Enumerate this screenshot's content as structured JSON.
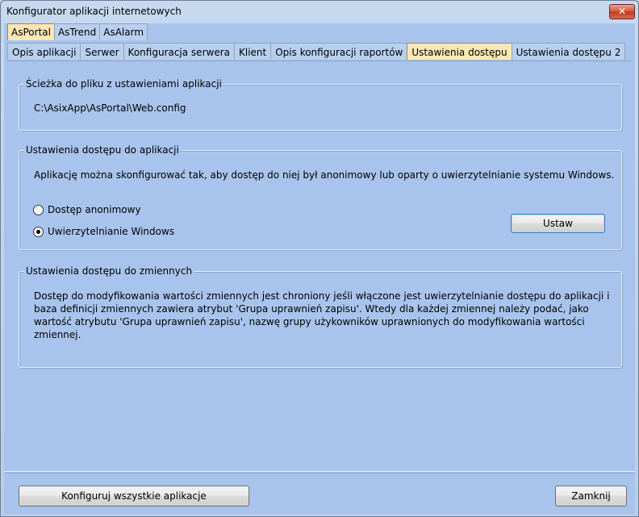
{
  "window": {
    "title": "Konfigurator aplikacji internetowych",
    "close_glyph": "✕"
  },
  "apps_tabs": [
    {
      "label": "AsPortal",
      "active": true
    },
    {
      "label": "AsTrend",
      "active": false
    },
    {
      "label": "AsAlarm",
      "active": false
    }
  ],
  "page_tabs": [
    {
      "label": "Opis aplikacji",
      "active": false
    },
    {
      "label": "Serwer",
      "active": false
    },
    {
      "label": "Konfiguracja serwera",
      "active": false
    },
    {
      "label": "Klient",
      "active": false
    },
    {
      "label": "Opis konfiguracji raportów",
      "active": false
    },
    {
      "label": "Ustawienia dostępu",
      "active": true
    },
    {
      "label": "Ustawienia dostępu 2",
      "active": false
    }
  ],
  "config_path_group": {
    "title": "Ścieżka do pliku z ustawieniami aplikacji",
    "path": "C:\\AsixApp\\AsPortal\\Web.config"
  },
  "access_group": {
    "title": "Ustawienia dostępu do aplikacji",
    "description": "Aplikację można skonfigurować tak, aby dostęp do niej był anonimowy lub oparty o uwierzytelnianie systemu Windows.",
    "option_anonymous": "Dostęp anonimowy",
    "option_windows": "Uwierzytelnianie Windows",
    "selected": "windows",
    "set_button": "Ustaw"
  },
  "variables_group": {
    "title": "Ustawienia dostępu do zmiennych",
    "description": "Dostęp do modyfikowania wartości zmiennych jest chroniony jeśli włączone jest uwierzytelnianie dostępu do aplikacji i baza definicji zmiennych zawiera atrybut 'Grupa uprawnień zapisu'. Wtedy dla każdej zmiennej należy podać, jako wartość atrybutu 'Grupa uprawnień zapisu', nazwę grupy użykowników uprawnionych do modyfikowania wartości zmiennej."
  },
  "footer": {
    "configure_all_button": "Konfiguruj wszystkie aplikacje",
    "close_button": "Zamknij"
  }
}
